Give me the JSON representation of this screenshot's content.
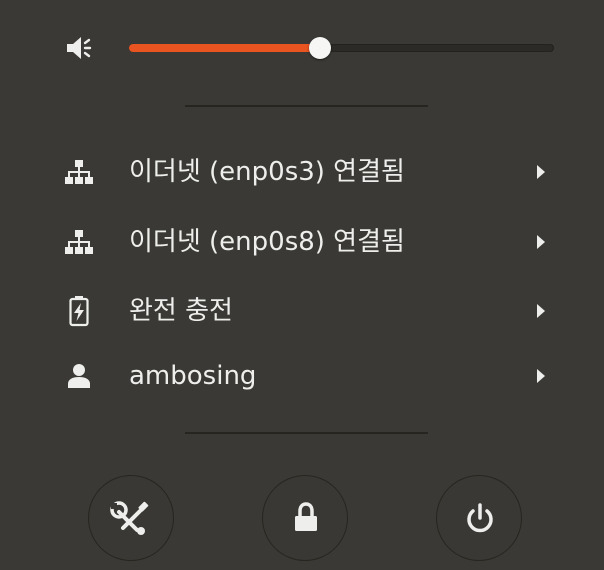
{
  "volume": {
    "level_fraction": 0.45,
    "icon": "audio-volume-low-icon",
    "fill_color": "#e95420"
  },
  "menu": {
    "items": [
      {
        "label": "이더넷 (enp0s3) 연결됨",
        "icon": "network-wired-icon"
      },
      {
        "label": "이더넷 (enp0s8) 연결됨",
        "icon": "network-wired-icon"
      },
      {
        "label": "완전 충전",
        "icon": "battery-charging-icon"
      },
      {
        "label": "ambosing",
        "icon": "user-icon"
      }
    ]
  },
  "actions": [
    {
      "icon": "settings-icon"
    },
    {
      "icon": "lock-icon"
    },
    {
      "icon": "power-icon"
    }
  ]
}
